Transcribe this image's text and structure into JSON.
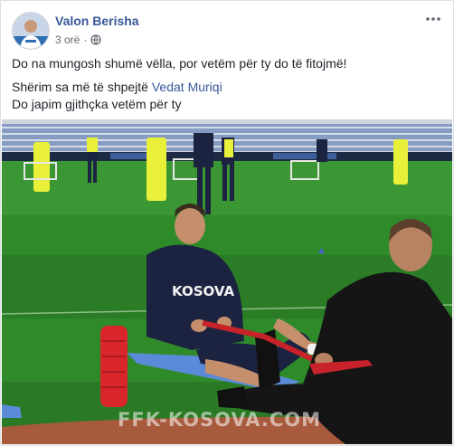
{
  "post": {
    "author": "Valon Berisha",
    "time": "3 orë",
    "audience_icon": "globe-icon",
    "more_icon": "more-horizontal-icon",
    "paragraph1": "Do na mungosh shumë vëlla, por vetëm për ty do të fitojmë!",
    "line2_prefix": "Shërim sa më të shpejtë ",
    "line2_mention": "Vedat Muriqi",
    "line3": "Do japim gjithçka vetëm për ty"
  },
  "photo": {
    "shirt_text": "KOSOVA",
    "watermark": "FFK-KOSOVA.COM"
  },
  "colors": {
    "link": "#385898",
    "text": "#1d2129",
    "meta": "#616770",
    "pitch": "#2f8a2a",
    "kit_navy": "#1c2340"
  }
}
